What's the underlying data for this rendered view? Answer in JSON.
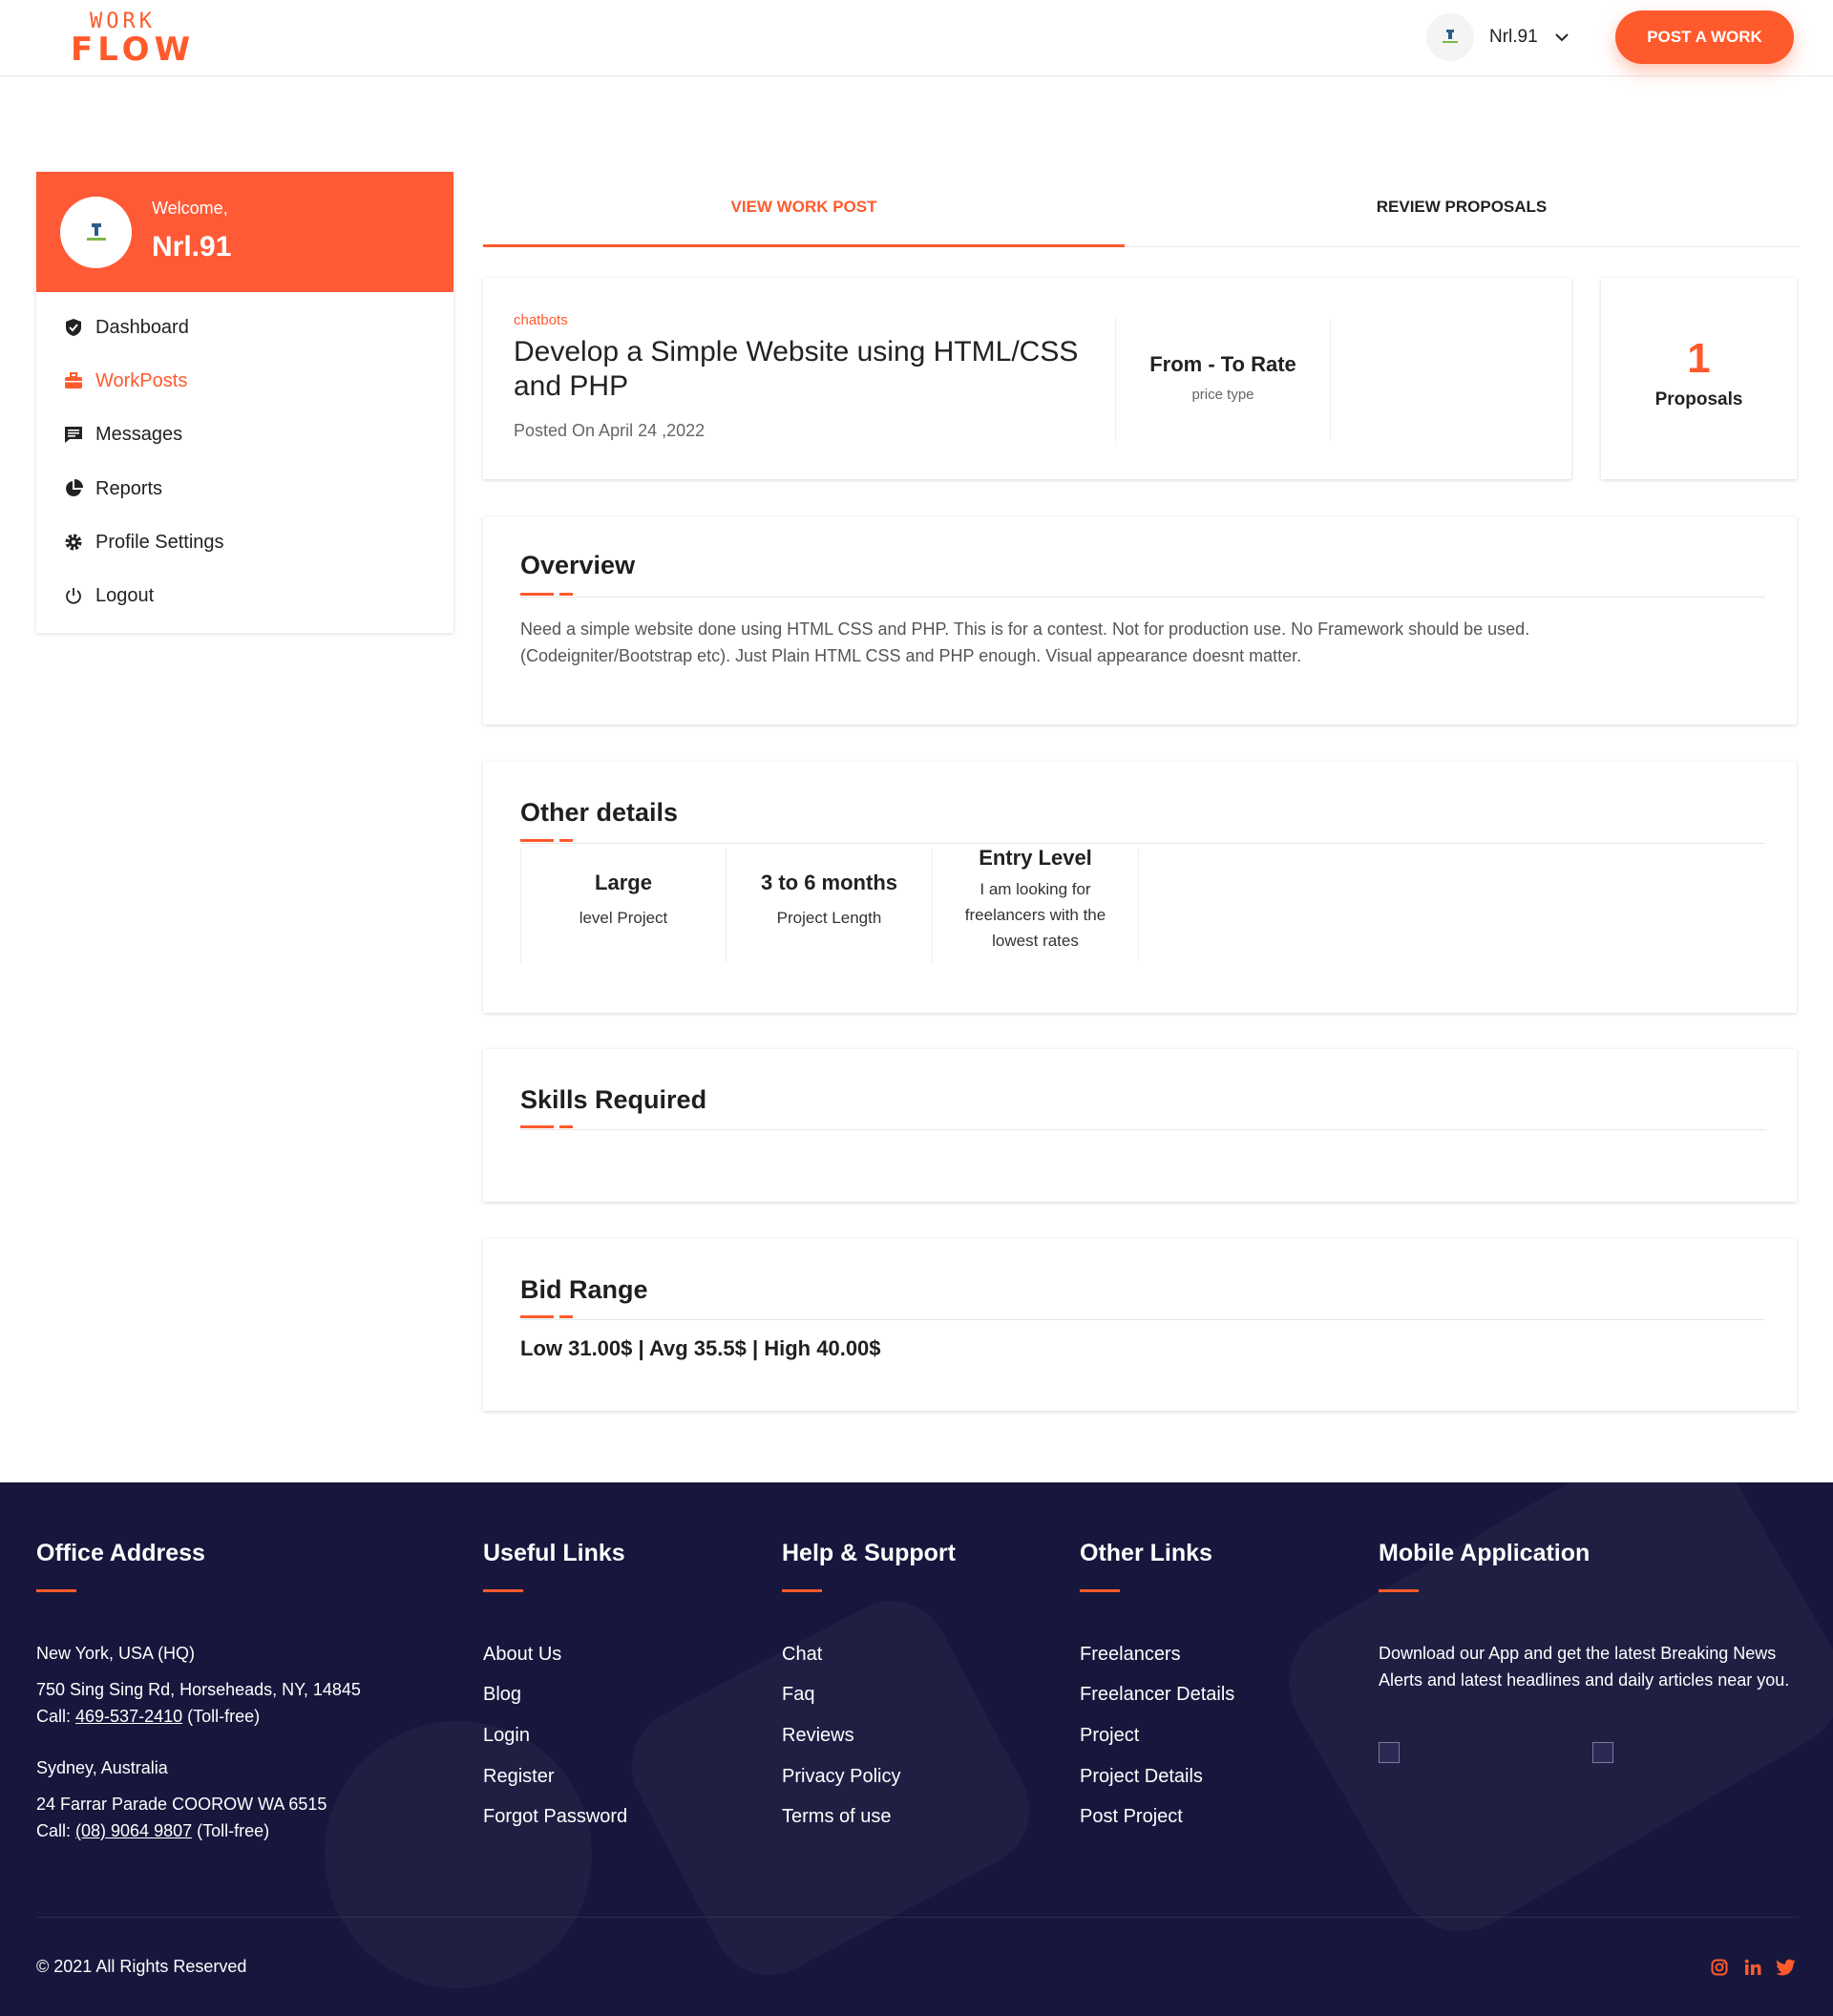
{
  "header": {
    "logo_top": "WORK",
    "logo_bottom": "FLOW",
    "user_name": "Nrl.91",
    "post_button": "POST A WORK"
  },
  "sidebar": {
    "welcome": "Welcome,",
    "name": "Nrl.91",
    "items": [
      {
        "label": "Dashboard",
        "icon": "shield-icon"
      },
      {
        "label": "WorkPosts",
        "icon": "briefcase-icon"
      },
      {
        "label": "Messages",
        "icon": "message-icon"
      },
      {
        "label": "Reports",
        "icon": "pie-chart-icon"
      },
      {
        "label": "Profile Settings",
        "icon": "gear-icon"
      },
      {
        "label": "Logout",
        "icon": "power-icon"
      }
    ]
  },
  "tabs": [
    "VIEW WORK POST",
    "REVIEW PROPOSALS"
  ],
  "post": {
    "category": "chatbots",
    "title": "Develop a Simple Website using HTML/CSS and PHP",
    "posted": "Posted On April 24 ,2022",
    "rate_title": "From - To Rate",
    "rate_sub": "price type",
    "proposals_count": "1",
    "proposals_label": "Proposals"
  },
  "overview": {
    "title": "Overview",
    "text": "Need a simple website done using HTML CSS and PHP. This is for a contest. Not for production use. No Framework should be used. (Codeigniter/Bootstrap etc). Just Plain HTML CSS and PHP enough. Visual appearance doesnt matter."
  },
  "other_details": {
    "title": "Other details",
    "items": [
      {
        "title": "Large",
        "sub": "level Project"
      },
      {
        "title": "3 to 6 months",
        "sub": "Project Length"
      },
      {
        "title": "Entry Level",
        "sub": "I am looking for freelancers with the lowest rates"
      }
    ]
  },
  "skills": {
    "title": "Skills Required"
  },
  "bid": {
    "title": "Bid Range",
    "text": "Low 31.00$ | Avg 35.5$ | High 40.00$"
  },
  "footer": {
    "office": {
      "title": "Office Address",
      "hq": "New York, USA (HQ)",
      "hq_address": "750 Sing Sing Rd, Horseheads, NY, 14845",
      "hq_call_prefix": "Call: ",
      "hq_phone": "469-537-2410",
      "hq_call_suffix": " (Toll-free)",
      "au": "Sydney, Australia",
      "au_address": "24 Farrar Parade COOROW WA 6515",
      "au_call_prefix": "Call: ",
      "au_phone": "(08) 9064 9807",
      "au_call_suffix": " (Toll-free)"
    },
    "useful": {
      "title": "Useful Links",
      "links": [
        "About Us",
        "Blog",
        "Login",
        "Register",
        "Forgot Password"
      ]
    },
    "help": {
      "title": "Help & Support",
      "links": [
        "Chat",
        "Faq",
        "Reviews",
        "Privacy Policy",
        "Terms of use"
      ]
    },
    "other": {
      "title": "Other Links",
      "links": [
        "Freelancers",
        "Freelancer Details",
        "Project",
        "Project Details",
        "Post Project"
      ]
    },
    "mobile": {
      "title": "Mobile Application",
      "text": "Download our App and get the latest Breaking News Alerts and latest headlines and daily articles near you."
    },
    "copyright": "© 2021 All Rights Reserved",
    "social": [
      "instagram-icon",
      "linkedin-icon",
      "twitter-icon"
    ]
  },
  "colors": {
    "accent": "#ff5a2c",
    "footer_bg": "#17173d"
  }
}
